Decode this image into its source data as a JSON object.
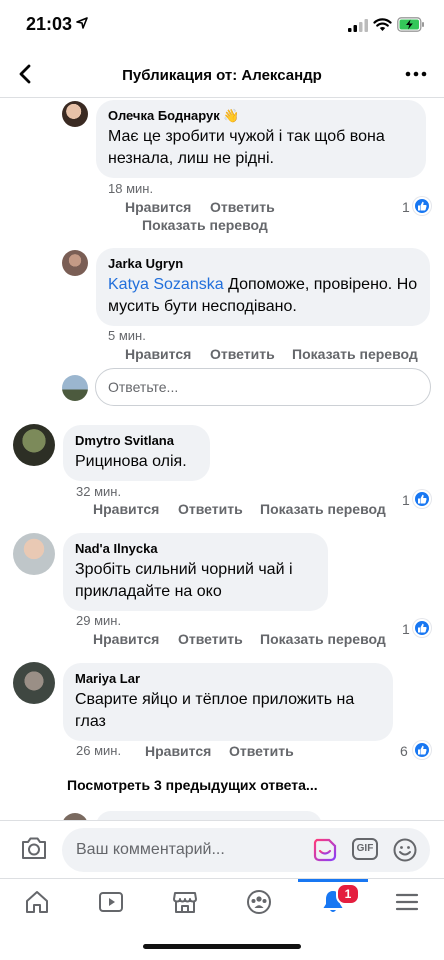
{
  "status_bar": {
    "time": "21:03"
  },
  "nav": {
    "title": "Публикация от: Александр"
  },
  "colors": {
    "accent": "#1877f2",
    "bubble": "#f0f2f5",
    "meta": "#65676b",
    "badge": "#e41e3f",
    "mention": "#216fdb"
  },
  "replies": [
    {
      "author": "Олечка Боднарук 👋",
      "text": "Має це зробити чужой і так щоб вона незнала, лиш не рідні.",
      "time": "18 мин.",
      "like_label": "Нравится",
      "reply_label": "Ответить",
      "translate_label": "Показать перевод",
      "reactions": "1"
    },
    {
      "author": "Jarka Ugryn",
      "mention": "Katya Sozanska",
      "text": " Допоможе, провірено. Но мусить бути несподівано.",
      "time": "5 мин.",
      "like_label": "Нравится",
      "reply_label": "Ответить",
      "translate_label": "Показать перевод"
    }
  ],
  "reply_box": {
    "placeholder": "Ответьте..."
  },
  "comments": [
    {
      "author": "Dmytro Svitlana",
      "text": "Рицинова олія.",
      "time": "32 мин.",
      "like_label": "Нравится",
      "reply_label": "Ответить",
      "translate_label": "Показать перевод",
      "reactions": "1"
    },
    {
      "author": "Nad'a Ilnycka",
      "text": "Зробіть сильний чорний чай і прикладайте на око",
      "time": "29 мин.",
      "like_label": "Нравится",
      "reply_label": "Ответить",
      "translate_label": "Показать перевод",
      "reactions": "1"
    },
    {
      "author": "Mariya Lar",
      "text": "Сварите яйцо и тёплое приложить на глаз",
      "time": "26 мин.",
      "like_label": "Нравится",
      "reply_label": "Ответить",
      "reactions": "6"
    }
  ],
  "view_previous": "Посмотреть 3 предыдущих ответа...",
  "composer": {
    "placeholder": "Ваш комментарий...",
    "gif_label": "GIF"
  },
  "tab_bar": {
    "tabs": [
      "home-icon",
      "video-icon",
      "marketplace-icon",
      "groups-icon",
      "notifications-icon",
      "menu-icon"
    ],
    "notifications_badge": "1"
  }
}
